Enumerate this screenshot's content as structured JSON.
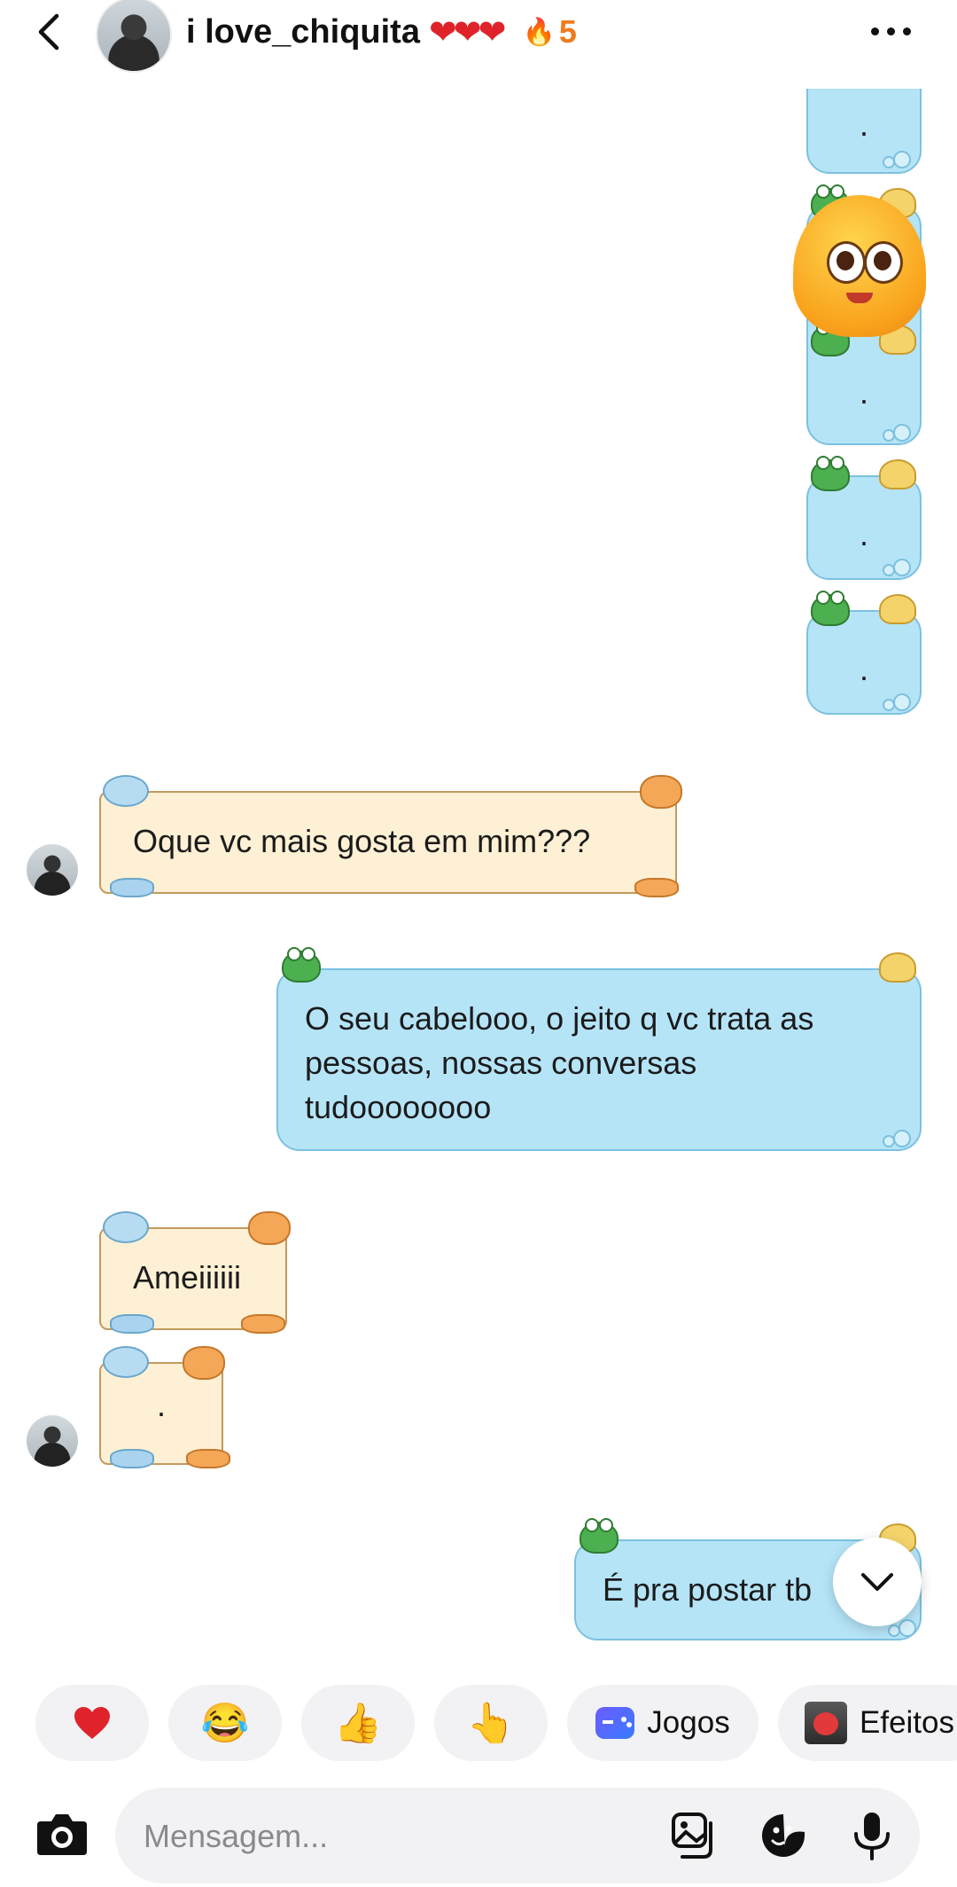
{
  "header": {
    "contact_name": "i love_chiquita",
    "hearts": "❤❤❤",
    "streak_icon": "flame-icon",
    "streak_count": "5"
  },
  "messages": [
    {
      "id": "s1",
      "from": "me",
      "text": "."
    },
    {
      "id": "s2",
      "from": "me",
      "text": "."
    },
    {
      "id": "s3",
      "from": "me",
      "text": "."
    },
    {
      "id": "s4",
      "from": "me",
      "text": "."
    },
    {
      "id": "r1",
      "from": "them",
      "text": "Oque vc mais gosta em mim???"
    },
    {
      "id": "s5",
      "from": "me",
      "lines": [
        "O seu cabelooo, o jeito q vc trata as",
        "pessoas, nossas conversas",
        "tudoooooooo"
      ]
    },
    {
      "id": "r2",
      "from": "them",
      "text": "Ameiiiiii"
    },
    {
      "id": "r3",
      "from": "them",
      "text": "."
    },
    {
      "id": "s6",
      "from": "me",
      "text": "É pra postar tb"
    }
  ],
  "quick_replies": [
    {
      "emoji": "❤️",
      "name": "heart"
    },
    {
      "emoji": "😂",
      "name": "laughing"
    },
    {
      "emoji": "👍",
      "name": "thumbs-up"
    },
    {
      "emoji": "👆",
      "name": "pointing-up"
    },
    {
      "label": "Jogos",
      "icon": "games-icon"
    },
    {
      "label": "Efeitos",
      "icon": "effects-icon"
    }
  ],
  "composer": {
    "placeholder": "Mensagem..."
  },
  "colors": {
    "sent_bubble": "#b5e4f7",
    "received_bubble": "#fdf0d4",
    "streak": "#f07b1d",
    "heart": "#e0232b"
  }
}
